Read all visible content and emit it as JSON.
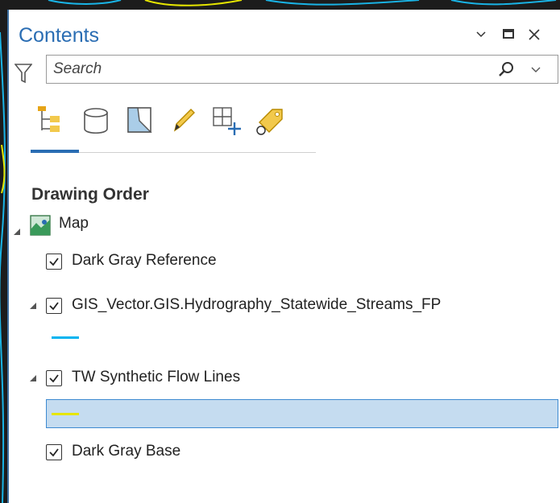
{
  "pane": {
    "title": "Contents"
  },
  "search": {
    "placeholder": "Search"
  },
  "toolbar": {
    "icons": [
      "list-by-drawing-order-icon",
      "list-by-data-source-icon",
      "list-by-selection-icon",
      "list-by-editing-icon",
      "list-by-snapping-icon",
      "list-by-labeling-icon"
    ]
  },
  "tree": {
    "heading": "Drawing Order",
    "map_label": "Map",
    "layers": [
      {
        "label": "Dark Gray Reference",
        "checked": true
      },
      {
        "label": "GIS_Vector.GIS.Hydrography_Statewide_Streams_FP",
        "checked": true,
        "symbol_color": "#00b4f0"
      },
      {
        "label": "TW Synthetic Flow Lines",
        "checked": true,
        "symbol_color": "#e6e600"
      },
      {
        "label": "Dark Gray Base",
        "checked": true
      }
    ]
  },
  "colors": {
    "accent": "#2a6db3",
    "selection": "#c5dcf0"
  }
}
